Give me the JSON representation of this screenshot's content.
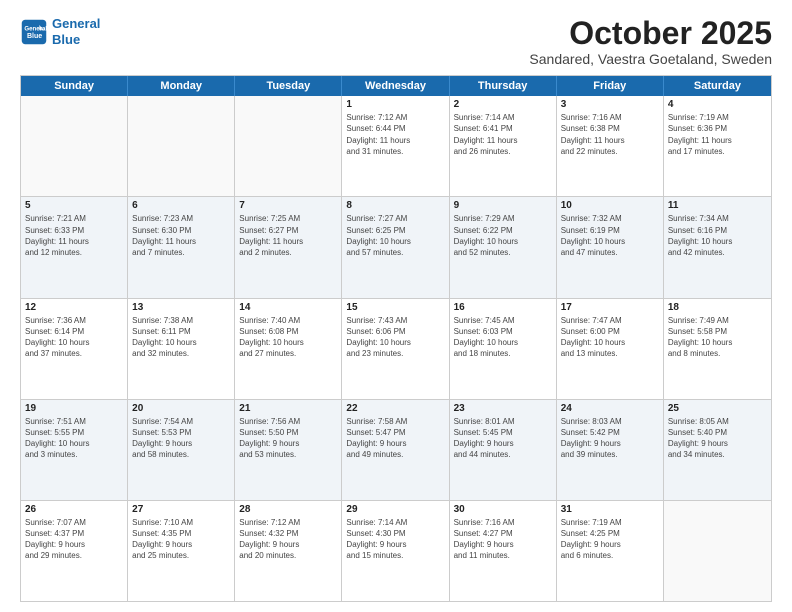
{
  "header": {
    "logo_line1": "General",
    "logo_line2": "Blue",
    "title": "October 2025",
    "subtitle": "Sandared, Vaestra Goetaland, Sweden"
  },
  "days": [
    "Sunday",
    "Monday",
    "Tuesday",
    "Wednesday",
    "Thursday",
    "Friday",
    "Saturday"
  ],
  "weeks": [
    [
      {
        "date": "",
        "info": ""
      },
      {
        "date": "",
        "info": ""
      },
      {
        "date": "",
        "info": ""
      },
      {
        "date": "1",
        "info": "Sunrise: 7:12 AM\nSunset: 6:44 PM\nDaylight: 11 hours\nand 31 minutes."
      },
      {
        "date": "2",
        "info": "Sunrise: 7:14 AM\nSunset: 6:41 PM\nDaylight: 11 hours\nand 26 minutes."
      },
      {
        "date": "3",
        "info": "Sunrise: 7:16 AM\nSunset: 6:38 PM\nDaylight: 11 hours\nand 22 minutes."
      },
      {
        "date": "4",
        "info": "Sunrise: 7:19 AM\nSunset: 6:36 PM\nDaylight: 11 hours\nand 17 minutes."
      }
    ],
    [
      {
        "date": "5",
        "info": "Sunrise: 7:21 AM\nSunset: 6:33 PM\nDaylight: 11 hours\nand 12 minutes."
      },
      {
        "date": "6",
        "info": "Sunrise: 7:23 AM\nSunset: 6:30 PM\nDaylight: 11 hours\nand 7 minutes."
      },
      {
        "date": "7",
        "info": "Sunrise: 7:25 AM\nSunset: 6:27 PM\nDaylight: 11 hours\nand 2 minutes."
      },
      {
        "date": "8",
        "info": "Sunrise: 7:27 AM\nSunset: 6:25 PM\nDaylight: 10 hours\nand 57 minutes."
      },
      {
        "date": "9",
        "info": "Sunrise: 7:29 AM\nSunset: 6:22 PM\nDaylight: 10 hours\nand 52 minutes."
      },
      {
        "date": "10",
        "info": "Sunrise: 7:32 AM\nSunset: 6:19 PM\nDaylight: 10 hours\nand 47 minutes."
      },
      {
        "date": "11",
        "info": "Sunrise: 7:34 AM\nSunset: 6:16 PM\nDaylight: 10 hours\nand 42 minutes."
      }
    ],
    [
      {
        "date": "12",
        "info": "Sunrise: 7:36 AM\nSunset: 6:14 PM\nDaylight: 10 hours\nand 37 minutes."
      },
      {
        "date": "13",
        "info": "Sunrise: 7:38 AM\nSunset: 6:11 PM\nDaylight: 10 hours\nand 32 minutes."
      },
      {
        "date": "14",
        "info": "Sunrise: 7:40 AM\nSunset: 6:08 PM\nDaylight: 10 hours\nand 27 minutes."
      },
      {
        "date": "15",
        "info": "Sunrise: 7:43 AM\nSunset: 6:06 PM\nDaylight: 10 hours\nand 23 minutes."
      },
      {
        "date": "16",
        "info": "Sunrise: 7:45 AM\nSunset: 6:03 PM\nDaylight: 10 hours\nand 18 minutes."
      },
      {
        "date": "17",
        "info": "Sunrise: 7:47 AM\nSunset: 6:00 PM\nDaylight: 10 hours\nand 13 minutes."
      },
      {
        "date": "18",
        "info": "Sunrise: 7:49 AM\nSunset: 5:58 PM\nDaylight: 10 hours\nand 8 minutes."
      }
    ],
    [
      {
        "date": "19",
        "info": "Sunrise: 7:51 AM\nSunset: 5:55 PM\nDaylight: 10 hours\nand 3 minutes."
      },
      {
        "date": "20",
        "info": "Sunrise: 7:54 AM\nSunset: 5:53 PM\nDaylight: 9 hours\nand 58 minutes."
      },
      {
        "date": "21",
        "info": "Sunrise: 7:56 AM\nSunset: 5:50 PM\nDaylight: 9 hours\nand 53 minutes."
      },
      {
        "date": "22",
        "info": "Sunrise: 7:58 AM\nSunset: 5:47 PM\nDaylight: 9 hours\nand 49 minutes."
      },
      {
        "date": "23",
        "info": "Sunrise: 8:01 AM\nSunset: 5:45 PM\nDaylight: 9 hours\nand 44 minutes."
      },
      {
        "date": "24",
        "info": "Sunrise: 8:03 AM\nSunset: 5:42 PM\nDaylight: 9 hours\nand 39 minutes."
      },
      {
        "date": "25",
        "info": "Sunrise: 8:05 AM\nSunset: 5:40 PM\nDaylight: 9 hours\nand 34 minutes."
      }
    ],
    [
      {
        "date": "26",
        "info": "Sunrise: 7:07 AM\nSunset: 4:37 PM\nDaylight: 9 hours\nand 29 minutes."
      },
      {
        "date": "27",
        "info": "Sunrise: 7:10 AM\nSunset: 4:35 PM\nDaylight: 9 hours\nand 25 minutes."
      },
      {
        "date": "28",
        "info": "Sunrise: 7:12 AM\nSunset: 4:32 PM\nDaylight: 9 hours\nand 20 minutes."
      },
      {
        "date": "29",
        "info": "Sunrise: 7:14 AM\nSunset: 4:30 PM\nDaylight: 9 hours\nand 15 minutes."
      },
      {
        "date": "30",
        "info": "Sunrise: 7:16 AM\nSunset: 4:27 PM\nDaylight: 9 hours\nand 11 minutes."
      },
      {
        "date": "31",
        "info": "Sunrise: 7:19 AM\nSunset: 4:25 PM\nDaylight: 9 hours\nand 6 minutes."
      },
      {
        "date": "",
        "info": ""
      }
    ]
  ]
}
